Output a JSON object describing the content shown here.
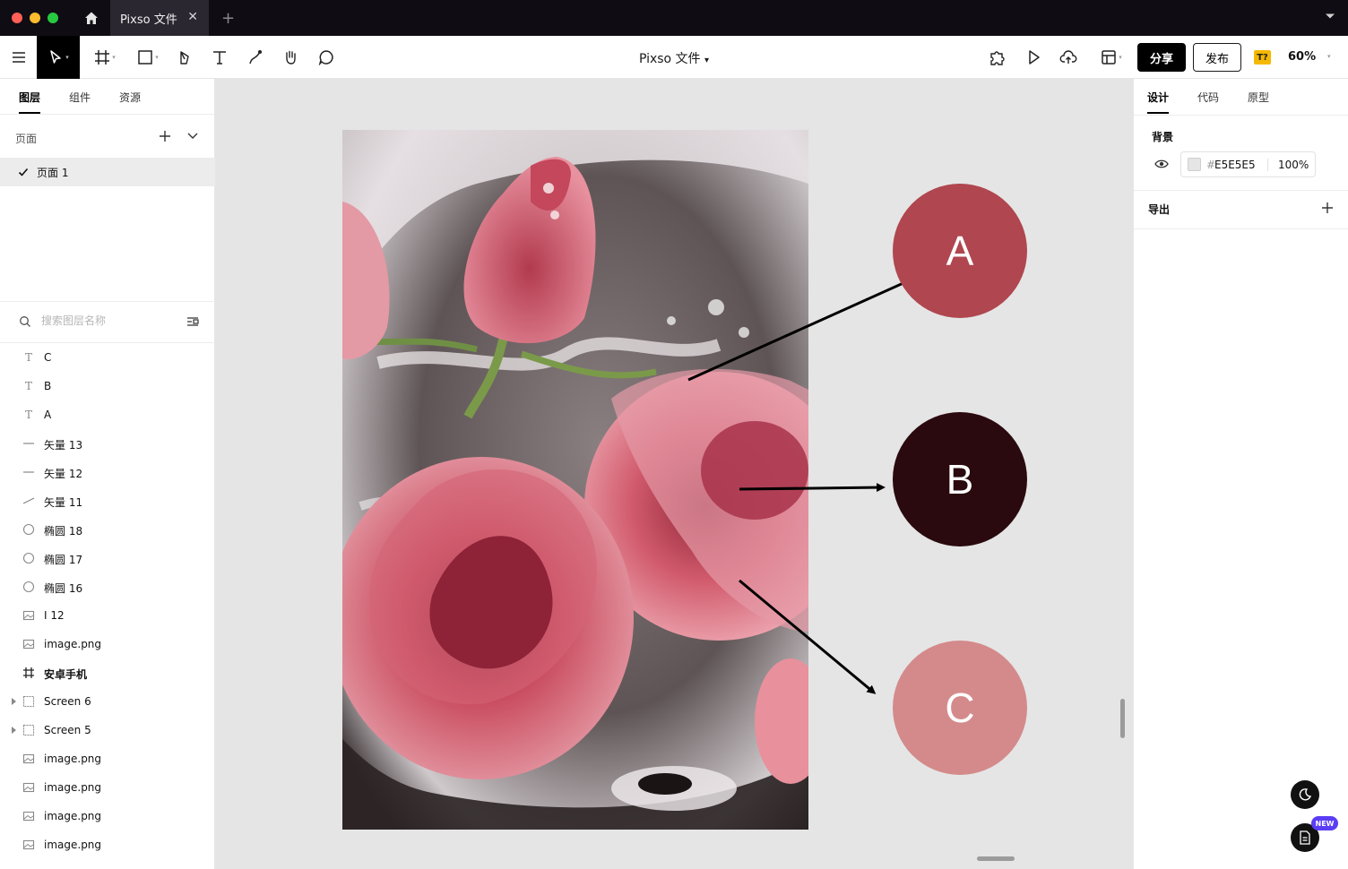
{
  "titlebar": {
    "tab_title": "Pixso 文件",
    "close_glyph": "✕",
    "new_tab_glyph": "+"
  },
  "toolbar": {
    "doc_title": "Pixso 文件",
    "doc_caret": "▾",
    "share_label": "分享",
    "publish_label": "发布",
    "badge": "T?",
    "zoom": "60%"
  },
  "left_panel": {
    "tabs": [
      "图层",
      "组件",
      "资源"
    ],
    "pages_label": "页面",
    "pages": [
      {
        "label": "页面 1",
        "selected": true
      }
    ],
    "search_placeholder": "搜索图层名称",
    "layers": [
      {
        "name": "C",
        "icon": "text-icon",
        "glyph": "T"
      },
      {
        "name": "B",
        "icon": "text-icon",
        "glyph": "T"
      },
      {
        "name": "A",
        "icon": "text-icon",
        "glyph": "T"
      },
      {
        "name": "矢量 13",
        "icon": "line-icon"
      },
      {
        "name": "矢量 12",
        "icon": "line-icon"
      },
      {
        "name": "矢量 11",
        "icon": "diagonal-line-icon"
      },
      {
        "name": "椭圆 18",
        "icon": "ellipse-icon"
      },
      {
        "name": "椭圆 17",
        "icon": "ellipse-icon"
      },
      {
        "name": "椭圆 16",
        "icon": "ellipse-icon"
      },
      {
        "name": "I 12",
        "icon": "image-icon"
      },
      {
        "name": "image.png",
        "icon": "image-icon"
      },
      {
        "name": "安卓手机",
        "icon": "frame-icon",
        "bold": true
      },
      {
        "name": "Screen 6",
        "icon": "screen-icon",
        "expandable": true
      },
      {
        "name": "Screen 5",
        "icon": "screen-icon",
        "expandable": true
      },
      {
        "name": "image.png",
        "icon": "image-icon"
      },
      {
        "name": "image.png",
        "icon": "image-icon"
      },
      {
        "name": "image.png",
        "icon": "image-icon"
      },
      {
        "name": "image.png",
        "icon": "image-icon"
      }
    ]
  },
  "canvas": {
    "circles": [
      {
        "label": "A",
        "color": "#B0464F"
      },
      {
        "label": "B",
        "color": "#2A0A0F"
      },
      {
        "label": "C",
        "color": "#D48A8B"
      }
    ]
  },
  "right_panel": {
    "tabs": [
      "设计",
      "代码",
      "原型"
    ],
    "background_label": "背景",
    "background_hash": "#",
    "background_hex": "E5E5E5",
    "background_opacity": "100%",
    "export_label": "导出",
    "new_badge": "NEW"
  },
  "colors": {
    "titlebar": "#0F0C14",
    "canvas_bg": "#E5E5E5",
    "accent_black": "#000000",
    "badge_yellow": "#F5B800",
    "new_badge_purple": "#5B3DF5"
  }
}
